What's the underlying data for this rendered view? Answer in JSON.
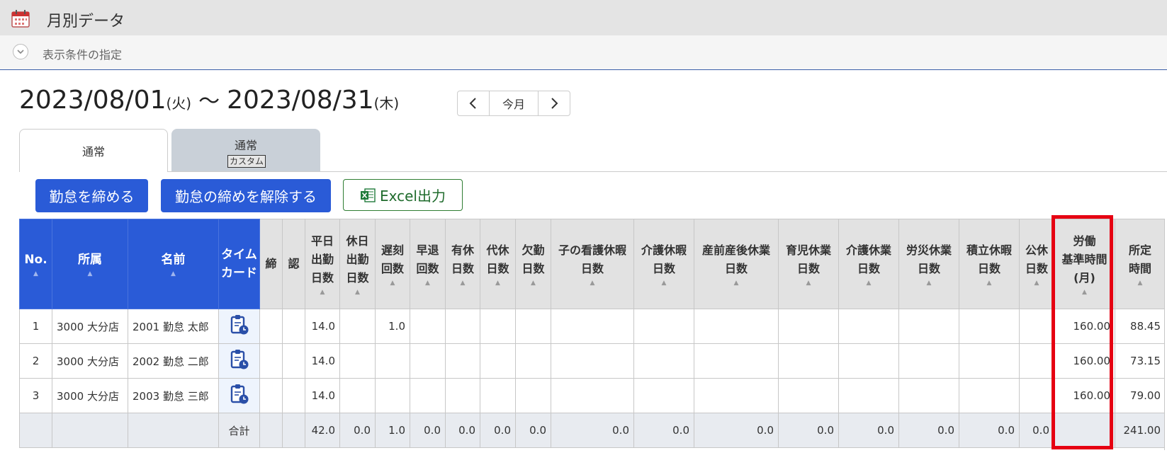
{
  "app": {
    "title": "月別データ"
  },
  "conditions": {
    "label": "表示条件の指定"
  },
  "period": {
    "start_date": "2023/08/01",
    "start_dow": "(火)",
    "separator": "〜",
    "end_date": "2023/08/31",
    "end_dow": "(木)"
  },
  "nav": {
    "current_label": "今月"
  },
  "tabs": [
    {
      "label": "通常"
    },
    {
      "label": "通常",
      "badge": "カスタム"
    }
  ],
  "actions": {
    "close_label": "勤怠を締める",
    "unclose_label": "勤怠の締めを解除する",
    "excel_label": "Excel出力"
  },
  "table": {
    "headers": {
      "no": "No.",
      "dept": "所属",
      "name": "名前",
      "timecard_1": "タイム",
      "timecard_2": "カード",
      "close": "締",
      "approve": "認",
      "h1a": "平日",
      "h1b": "出勤",
      "h1c": "日数",
      "h2a": "休日",
      "h2b": "出勤",
      "h2c": "日数",
      "h3a": "遅刻",
      "h3b": "回数",
      "h4a": "早退",
      "h4b": "回数",
      "h5a": "有休",
      "h5b": "日数",
      "h6a": "代休",
      "h6b": "日数",
      "h7a": "欠勤",
      "h7b": "日数",
      "h8a": "子の看護休暇",
      "h8b": "日数",
      "h9a": "介護休暇",
      "h9b": "日数",
      "h10a": "産前産後休業",
      "h10b": "日数",
      "h11a": "育児休業",
      "h11b": "日数",
      "h12a": "介護休業",
      "h12b": "日数",
      "h13a": "労災休業",
      "h13b": "日数",
      "h14a": "積立休暇",
      "h14b": "日数",
      "h15a": "公休",
      "h15b": "日数",
      "h16a": "労働",
      "h16b": "基準時間",
      "h16c": "(月)",
      "h17a": "所定",
      "h17b": "時間"
    },
    "rows": [
      {
        "no": "1",
        "dept": "3000 大分店",
        "name": "2001 勤怠 太郎",
        "weekday": "14.0",
        "late": "1.0",
        "std": "160.00",
        "sched": "88.45"
      },
      {
        "no": "2",
        "dept": "3000 大分店",
        "name": "2002 勤怠 二郎",
        "weekday": "14.0",
        "late": "",
        "std": "160.00",
        "sched": "73.15"
      },
      {
        "no": "3",
        "dept": "3000 大分店",
        "name": "2003 勤怠 三郎",
        "weekday": "14.0",
        "late": "",
        "std": "160.00",
        "sched": "79.00"
      }
    ],
    "total": {
      "label": "合計",
      "weekday": "42.0",
      "holiday": "0.0",
      "late": "1.0",
      "early": "0.0",
      "paid": "0.0",
      "comp": "0.0",
      "absent": "0.0",
      "childcare": "0.0",
      "nursing": "0.0",
      "maternity": "0.0",
      "parental": "0.0",
      "care_leave": "0.0",
      "injury": "0.0",
      "accum": "0.0",
      "public": "0.0",
      "std": "",
      "sched": "241.00"
    }
  },
  "colors": {
    "header_blue": "#2a5bd7",
    "highlight_red": "#e60012",
    "excel_green": "#1f6b2c"
  }
}
